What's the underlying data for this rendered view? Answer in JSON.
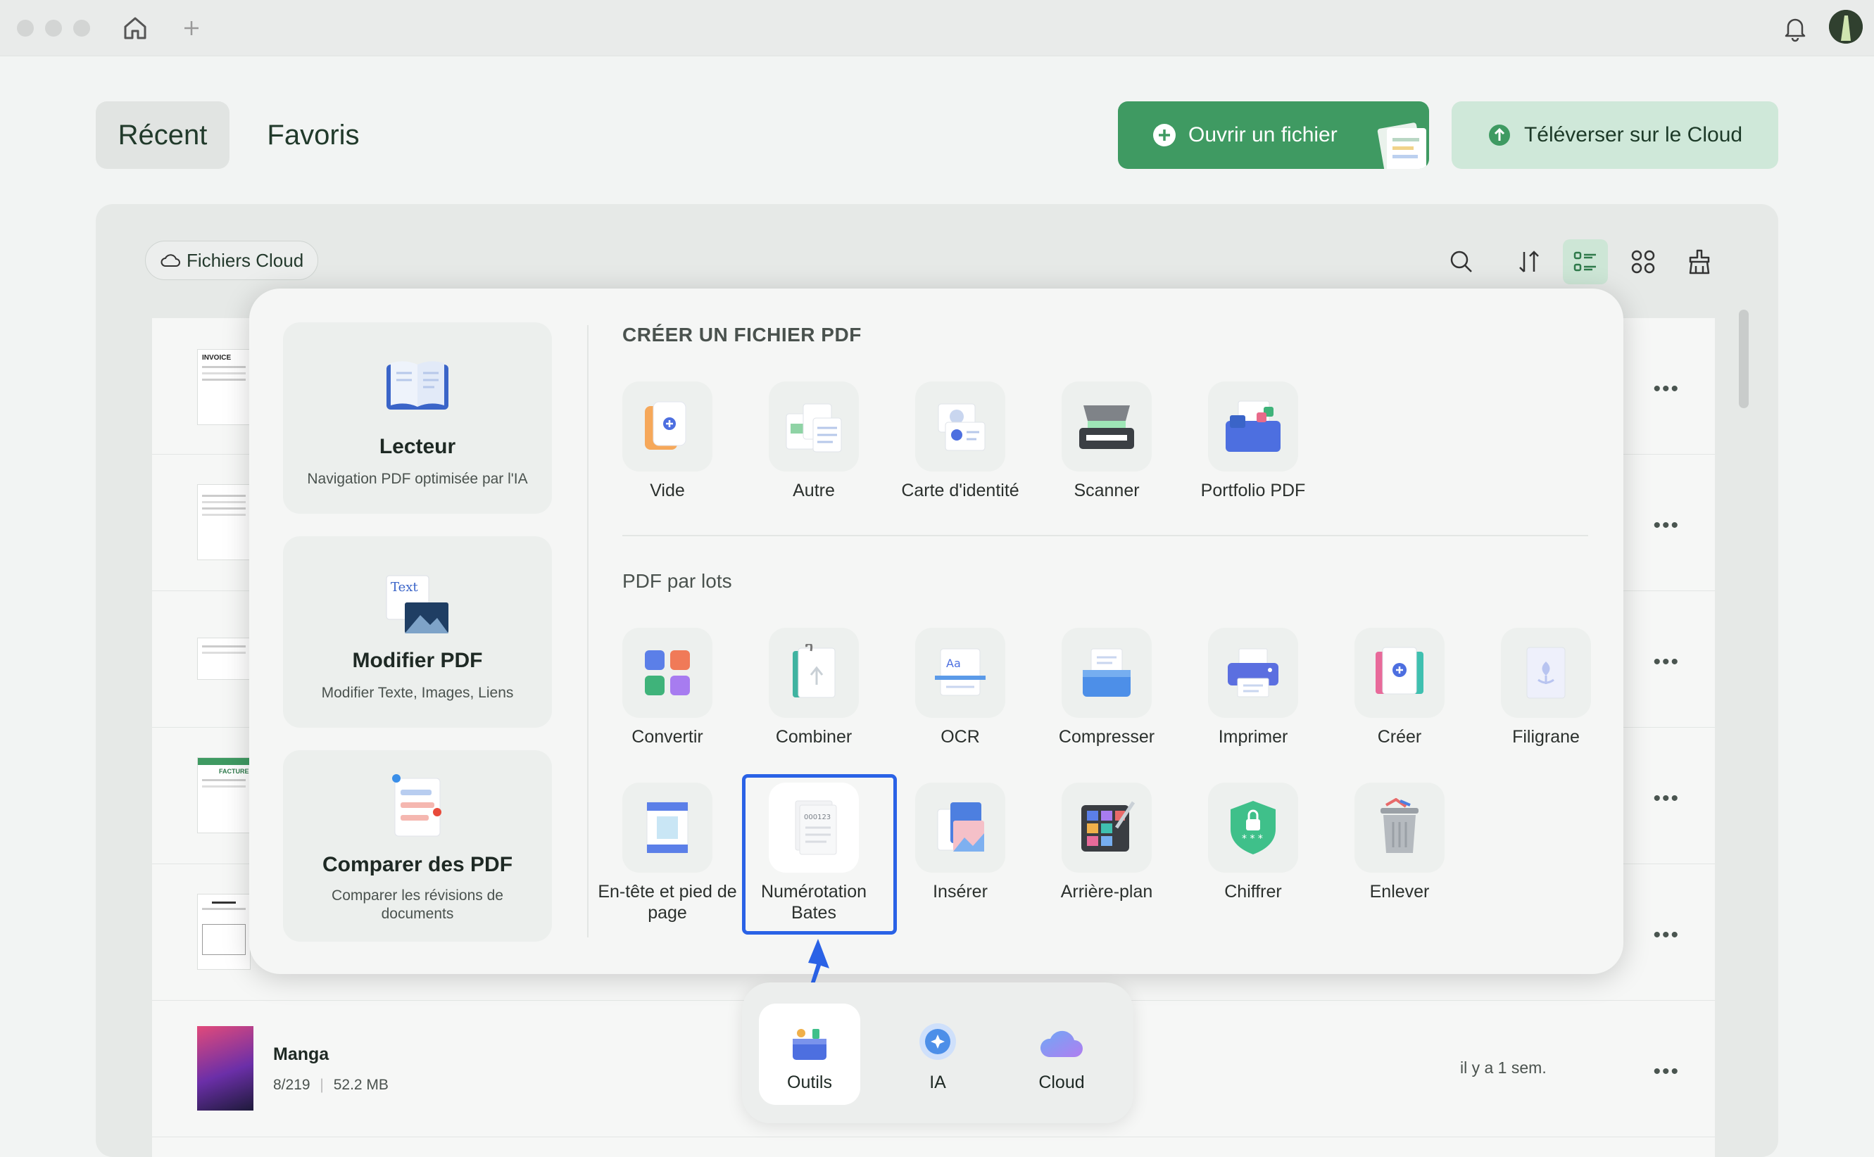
{
  "tabs": {
    "recent": "Récent",
    "favorites": "Favoris"
  },
  "actions": {
    "open_file": "Ouvrir un fichier",
    "upload_cloud": "Téléverser sur le Cloud"
  },
  "cloud_chip": "Fichiers Cloud",
  "reader": {
    "title": "Lecteur",
    "subtitle": "Navigation PDF optimisée par l'IA"
  },
  "edit": {
    "title": "Modifier PDF",
    "subtitle": "Modifier Texte, Images, Liens",
    "icon_text": "Text"
  },
  "compare": {
    "title": "Comparer des PDF",
    "subtitle": "Comparer les révisions de documents"
  },
  "create_section": {
    "title": "CRÉER UN FICHIER PDF",
    "items": [
      "Vide",
      "Autre",
      "Carte d'identité",
      "Scanner",
      "Portfolio PDF"
    ]
  },
  "batch_section": {
    "title": "PDF par lots",
    "items": [
      "Convertir",
      "Combiner",
      "OCR",
      "Compresser",
      "Imprimer",
      "Créer",
      "Filigrane",
      "En-tête et pied de page",
      "Numérotation Bates",
      "Insérer",
      "Arrière-plan",
      "Chiffrer",
      "Enlever"
    ]
  },
  "bates_number": "000123",
  "dock": {
    "tools": "Outils",
    "ai": "IA",
    "cloud": "Cloud"
  },
  "files": {
    "invoice_thumb": "INVOICE",
    "facture_thumb": "FACTURE",
    "manga": {
      "name": "Manga",
      "pages": "8/219",
      "size": "52.2 MB",
      "time": "il y a 1 sem."
    }
  },
  "colors": {
    "accent": "#3f9a62",
    "highlight": "#2a62e6"
  }
}
